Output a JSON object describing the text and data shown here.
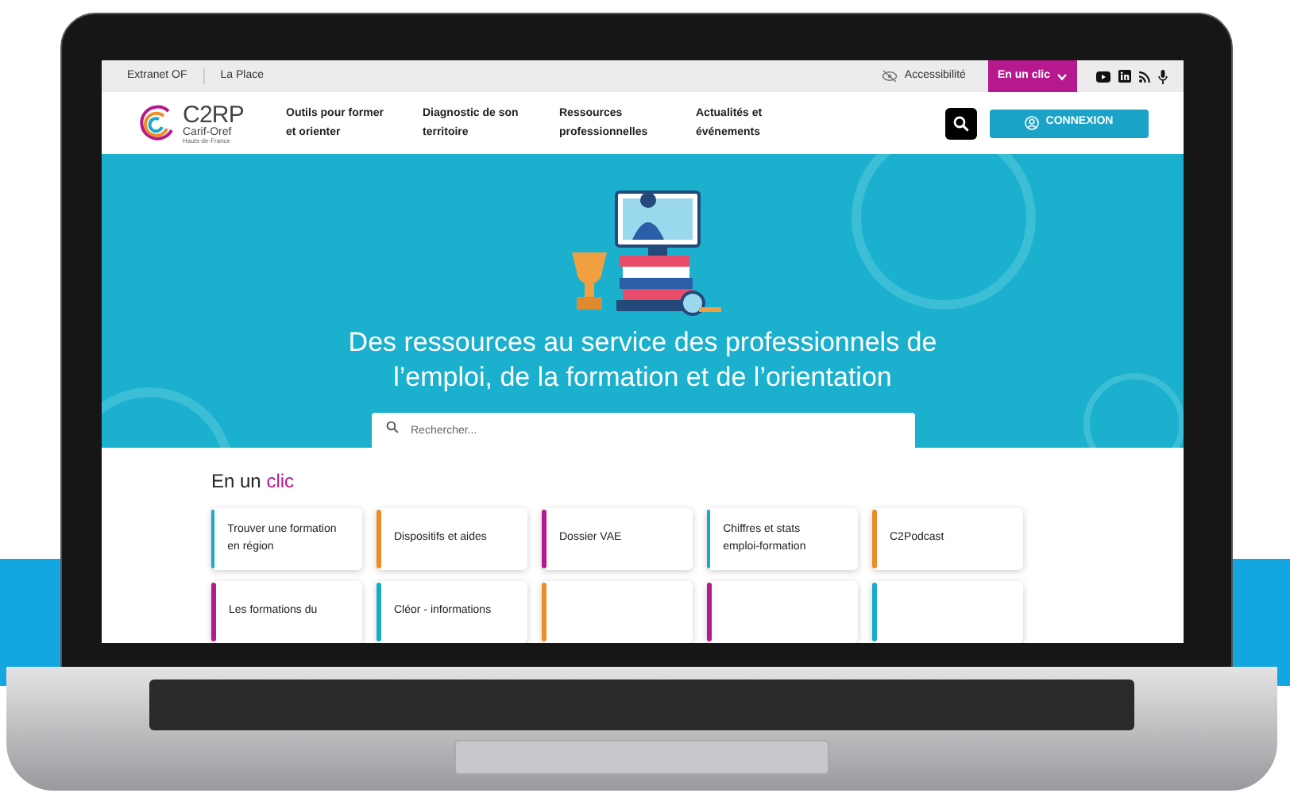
{
  "top_bar": {
    "links": [
      "Extranet OF",
      "La Place"
    ],
    "accessibility": "Accessibilité",
    "quick_menu": {
      "label": "En un clic",
      "expanded": false
    }
  },
  "header": {
    "logo": {
      "name": "C2RP",
      "line1": "Carif-Oref",
      "line2": "Hauts-de-France"
    },
    "nav": [
      "Outils pour former et orienter",
      "Diagnostic de son territoire",
      "Ressources professionnelles",
      "Actualités et événements"
    ],
    "login": "CONNEXION"
  },
  "hero": {
    "title": "Des ressources au service des professionnels de l’emploi, de la formation et de l’orientation",
    "search": {
      "placeholder": "Rechercher..."
    }
  },
  "quick_links": {
    "title_start": "En un",
    "title_highlight": "clic",
    "cards": [
      {
        "label": "Trouver une formation en région",
        "color": "#19a9c9"
      },
      {
        "label": "Dispositifs et aides",
        "color": "#f08c28"
      },
      {
        "label": "Dossier VAE",
        "color": "#b5198d"
      },
      {
        "label": "Chiffres et stats emploi-formation",
        "color": "#19a9c9"
      },
      {
        "label": "C2Podcast",
        "color": "#f08c28"
      },
      {
        "label": "Les formations du",
        "color": "#b5198d"
      },
      {
        "label": "Cléor - informations",
        "color": "#19a9c9"
      },
      {
        "color": "#f08c28"
      },
      {
        "color": "#b5198d"
      },
      {
        "color": "#19a9c9"
      }
    ]
  }
}
